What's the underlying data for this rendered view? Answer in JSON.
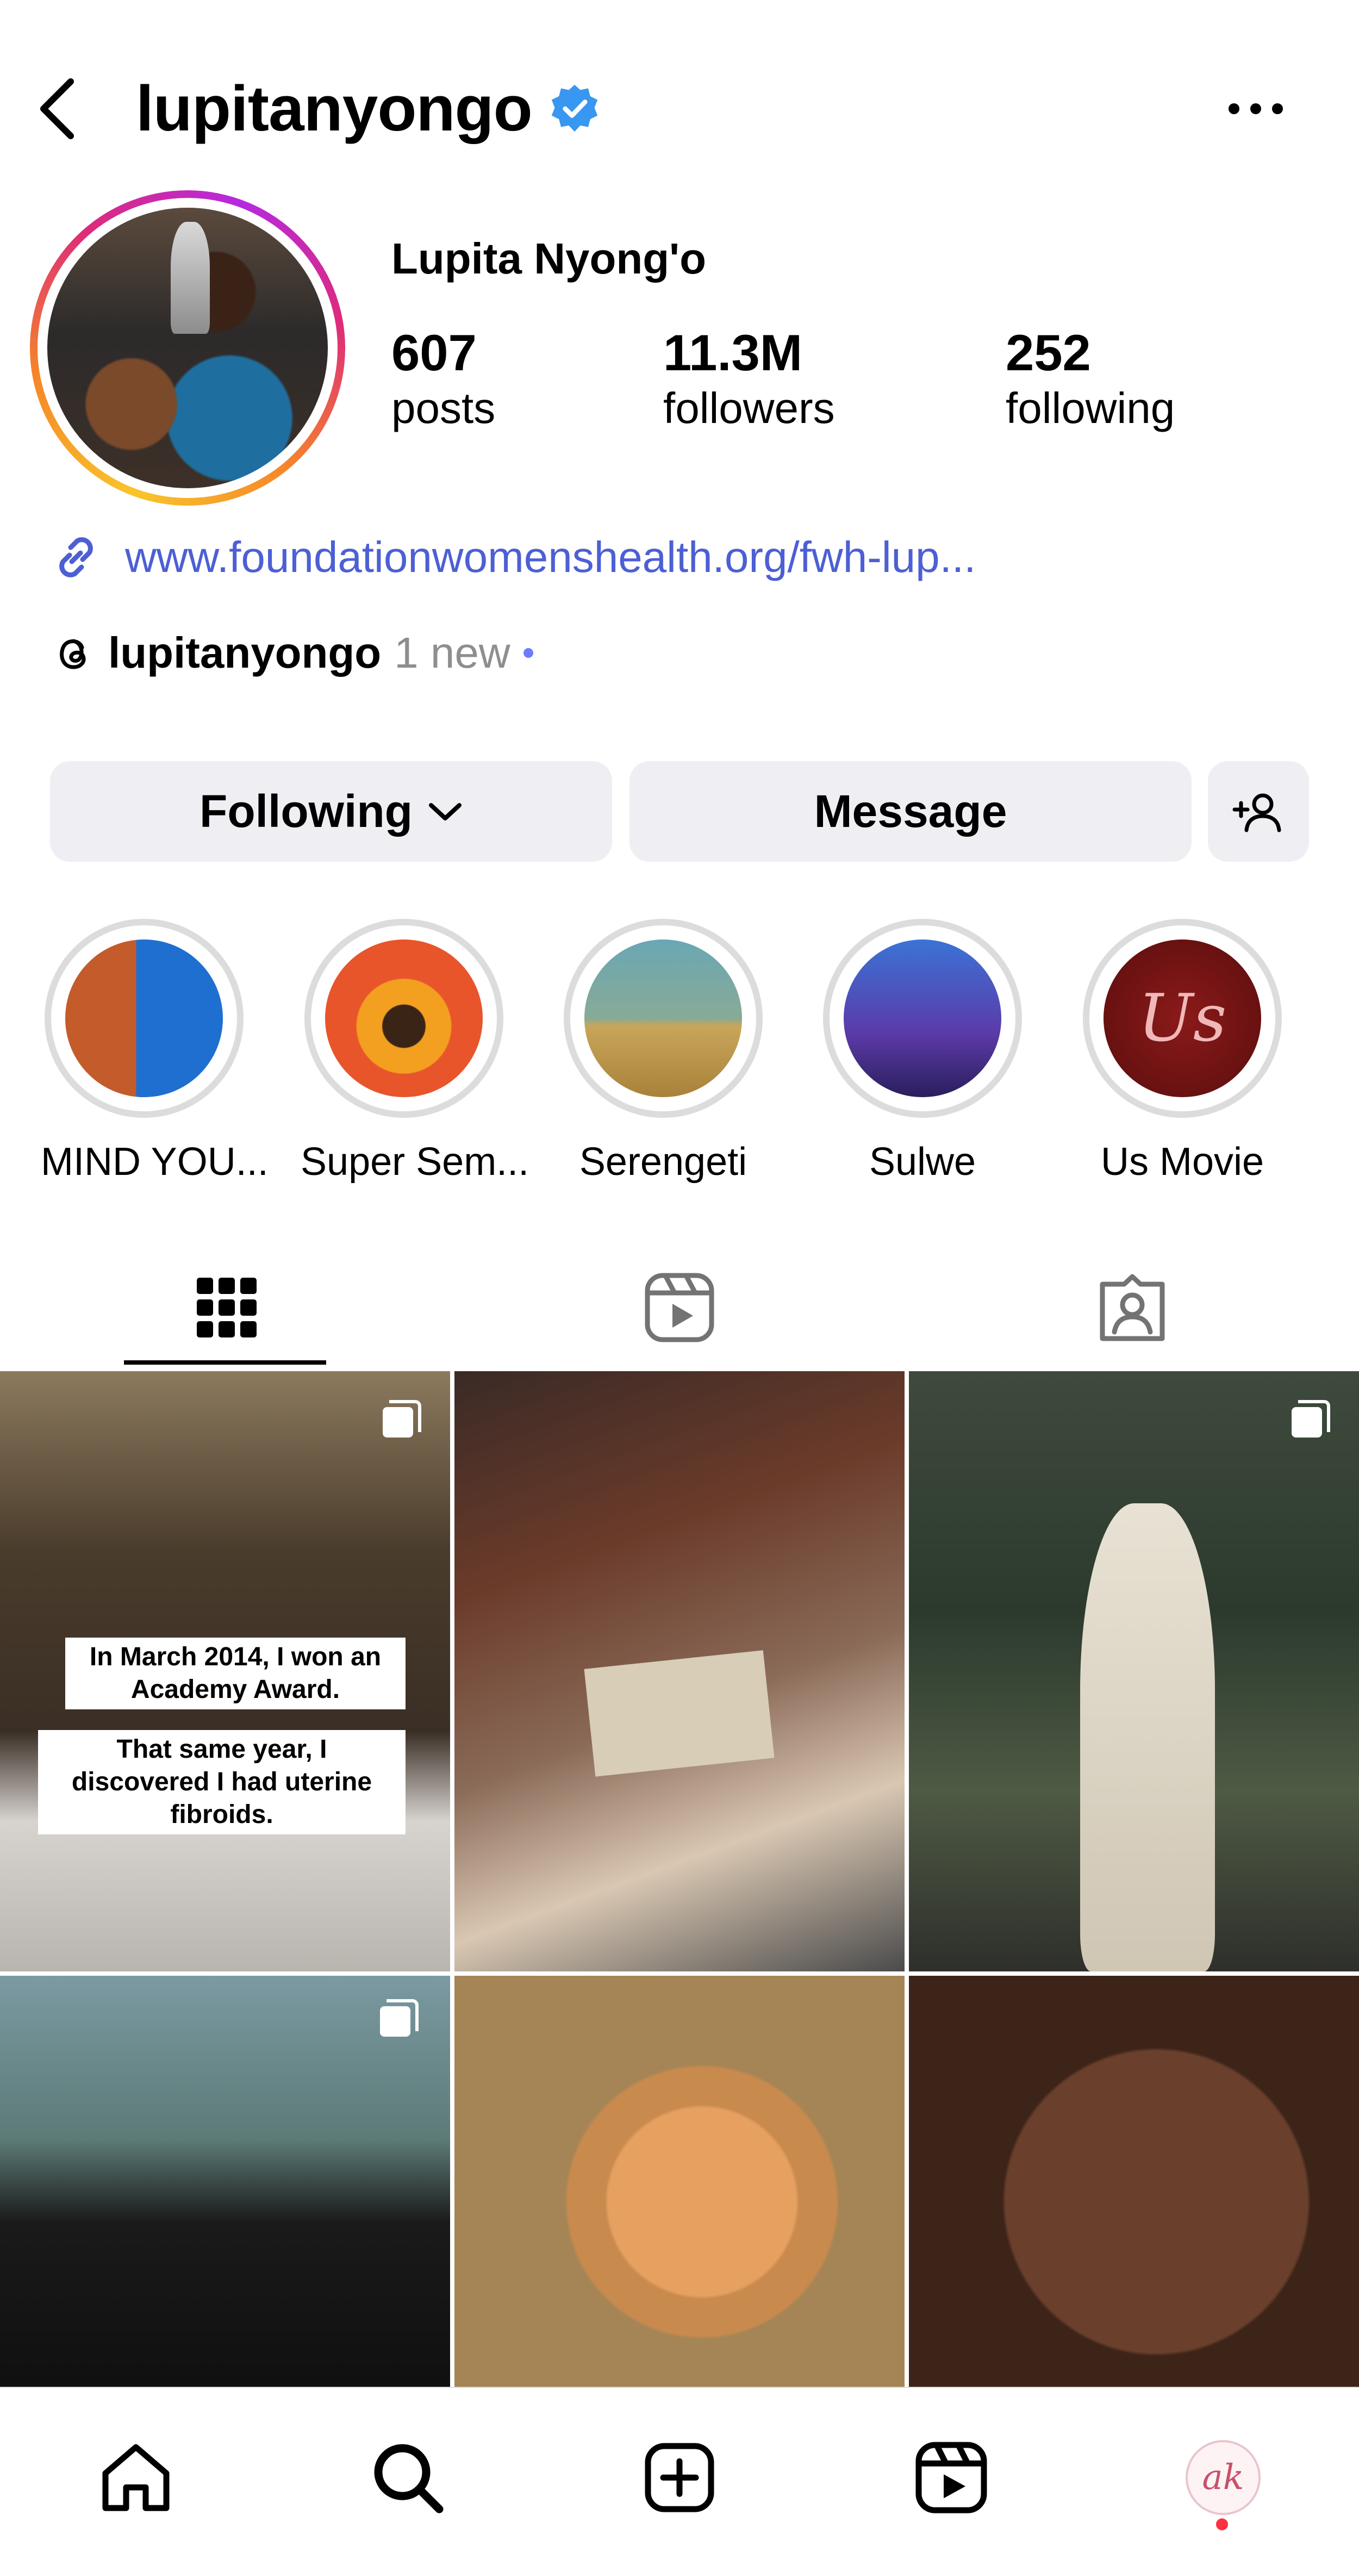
{
  "header": {
    "username": "lupitanyongo",
    "verified_icon": "verified-badge-icon",
    "back_icon": "chevron-left-icon",
    "more_icon": "more-horizontal-icon"
  },
  "profile": {
    "full_name": "Lupita Nyong'o",
    "stats": {
      "posts": {
        "value": "607",
        "label": "posts"
      },
      "followers": {
        "value": "11.3M",
        "label": "followers"
      },
      "following": {
        "value": "252",
        "label": "following"
      }
    },
    "link": "www.foundationwomenshealth.org/fwh-lup...",
    "threads": {
      "handle": "lupitanyongo",
      "badge": "1 new",
      "dot": "•"
    }
  },
  "actions": {
    "following_label": "Following",
    "message_label": "Message"
  },
  "highlights": [
    {
      "label": "MIND YOU..."
    },
    {
      "label": "Super Sem..."
    },
    {
      "label": "Serengeti"
    },
    {
      "label": "Sulwe"
    },
    {
      "label": "Us Movie"
    }
  ],
  "highlight_art": {
    "us_movie_text": "Us"
  },
  "tabs": [
    {
      "name": "posts-grid-tab",
      "icon": "grid-icon",
      "active": true
    },
    {
      "name": "reels-tab",
      "icon": "reels-icon",
      "active": false
    },
    {
      "name": "tagged-tab",
      "icon": "tagged-person-icon",
      "active": false
    }
  ],
  "posts": [
    {
      "caption_lines": [
        "In March 2014, I won an Academy Award.",
        "That same year, I discovered I had uterine fibroids."
      ],
      "multi": true
    },
    {
      "multi": false
    },
    {
      "multi": true
    },
    {
      "multi": true
    },
    {
      "multi": false
    },
    {
      "multi": false
    }
  ],
  "nav": {
    "items": [
      "home-icon",
      "search-icon",
      "create-icon",
      "reels-icon",
      "profile-avatar"
    ],
    "profile_initials": "ak"
  },
  "colors": {
    "link": "#4c5fd5",
    "verified": "#3897f0",
    "button_bg": "#efeff3",
    "notification": "#ff3040"
  }
}
